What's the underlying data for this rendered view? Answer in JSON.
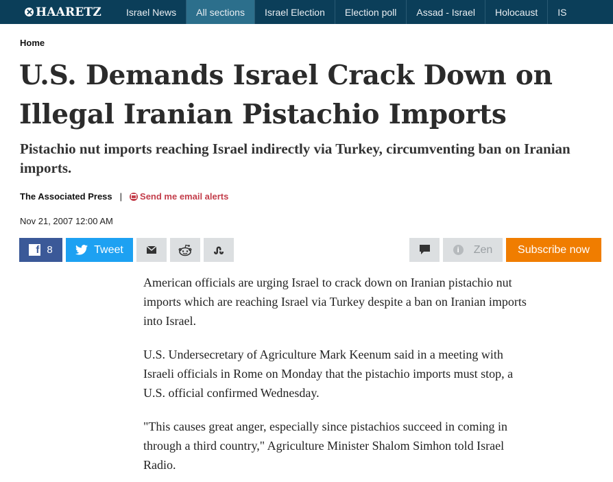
{
  "nav": {
    "logo": "HAARETZ",
    "items": [
      {
        "label": "Israel News"
      },
      {
        "label": "All sections"
      },
      {
        "label": "Israel Election"
      },
      {
        "label": "Election poll"
      },
      {
        "label": "Assad - Israel"
      },
      {
        "label": "Holocaust"
      },
      {
        "label": "IS"
      }
    ]
  },
  "breadcrumb": "Home",
  "headline": "U.S. Demands Israel Crack Down on Illegal Iranian Pistachio Imports",
  "subhead": "Pistachio nut imports reaching Israel indirectly via Turkey, circumventing ban on Iranian imports.",
  "byline": {
    "author": "The Associated Press",
    "separator": "|",
    "alert_link": "Send me email alerts"
  },
  "date": "Nov 21, 2007 12:00 AM",
  "share": {
    "facebook_count": "8",
    "tweet_label": "Tweet",
    "zen_label": "Zen",
    "subscribe_label": "Subscribe now"
  },
  "body": {
    "paragraphs": [
      "American officials are urging Israel to crack down on Iranian pistachio nut imports which are reaching Israel via Turkey despite a ban on Iranian imports into Israel.",
      "U.S. Undersecretary of Agriculture Mark Keenum said in a meeting with Israeli officials in Rome on Monday that the pistachio imports must stop, a U.S. official confirmed Wednesday.",
      "\"This causes great anger, especially since pistachios succeed in coming in through a third country,\" Agriculture Minister Shalom Simhon told Israel Radio."
    ]
  },
  "colors": {
    "nav_bg": "#0b3e59",
    "nav_active": "#2c6f8c",
    "facebook": "#3b5998",
    "twitter": "#1da1f2",
    "subscribe": "#f07d00",
    "alert": "#c33d4a"
  },
  "icons": [
    "haaretz-logo-icon",
    "facebook-icon",
    "twitter-icon",
    "email-icon",
    "reddit-icon",
    "stumbleupon-icon",
    "comment-icon",
    "zen-icon",
    "alert-envelope-icon"
  ]
}
